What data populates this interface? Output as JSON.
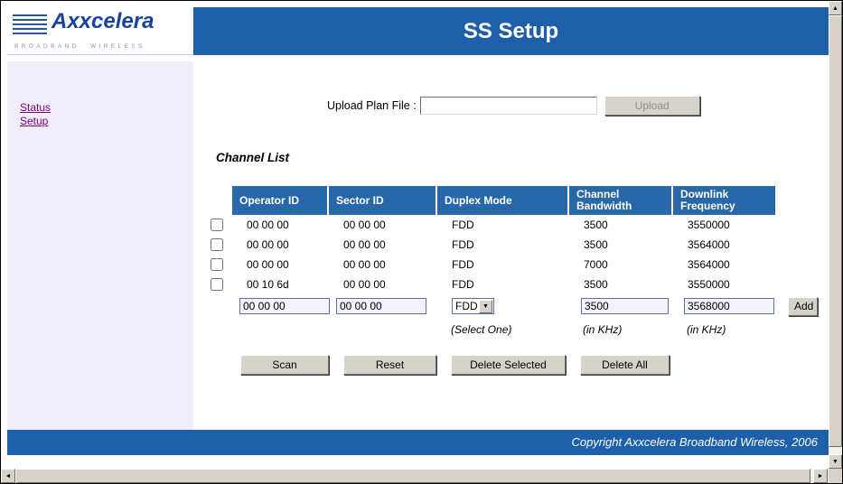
{
  "header": {
    "title": "SS Setup",
    "logo": {
      "brand": "Axxcelera",
      "tagline": "BROADBAND WIRELESS"
    }
  },
  "sidebar": {
    "links": [
      {
        "label": "Status"
      },
      {
        "label": "Setup"
      }
    ]
  },
  "upload": {
    "label": "Upload Plan File :",
    "value": "",
    "button": "Upload"
  },
  "channel_list": {
    "heading": "Channel List",
    "columns": [
      "Operator ID",
      "Sector ID",
      "Duplex Mode",
      "Channel Bandwidth",
      "Downlink Frequency"
    ],
    "rows": [
      {
        "operator_id": "00 00 00",
        "sector_id": "00 00 00",
        "duplex_mode": "FDD",
        "channel_bandwidth": "3500",
        "downlink_frequency": "3550000"
      },
      {
        "operator_id": "00 00 00",
        "sector_id": "00 00 00",
        "duplex_mode": "FDD",
        "channel_bandwidth": "3500",
        "downlink_frequency": "3564000"
      },
      {
        "operator_id": "00 00 00",
        "sector_id": "00 00 00",
        "duplex_mode": "FDD",
        "channel_bandwidth": "7000",
        "downlink_frequency": "3564000"
      },
      {
        "operator_id": "00 10 6d",
        "sector_id": "00 00 00",
        "duplex_mode": "FDD",
        "channel_bandwidth": "3500",
        "downlink_frequency": "3550000"
      }
    ],
    "add_row": {
      "operator_id": "00 00 00",
      "sector_id": "00 00 00",
      "duplex_mode": "FDD",
      "channel_bandwidth": "3500",
      "downlink_frequency": "3568000",
      "add_button": "Add"
    },
    "notes": {
      "duplex_mode": "(Select One)",
      "channel_bandwidth": "(in KHz)",
      "downlink_frequency": "(in KHz)"
    }
  },
  "actions": {
    "scan": "Scan",
    "reset": "Reset",
    "delete_selected": "Delete Selected",
    "delete_all": "Delete All"
  },
  "footer": {
    "copyright": "Copyright Axxcelera Broadband Wireless, 2006"
  },
  "icons": {
    "up": "▲",
    "down": "▼",
    "left": "◄",
    "right": "►",
    "select_arrow": "▼"
  },
  "colors": {
    "header_blue": "#1d5fa8",
    "table_header_blue": "#2968a8",
    "sidebar_bg": "#f1eefb",
    "link_purple": "#800080",
    "field_bg": "#f4f3fd",
    "field_border": "#5a6fae"
  }
}
